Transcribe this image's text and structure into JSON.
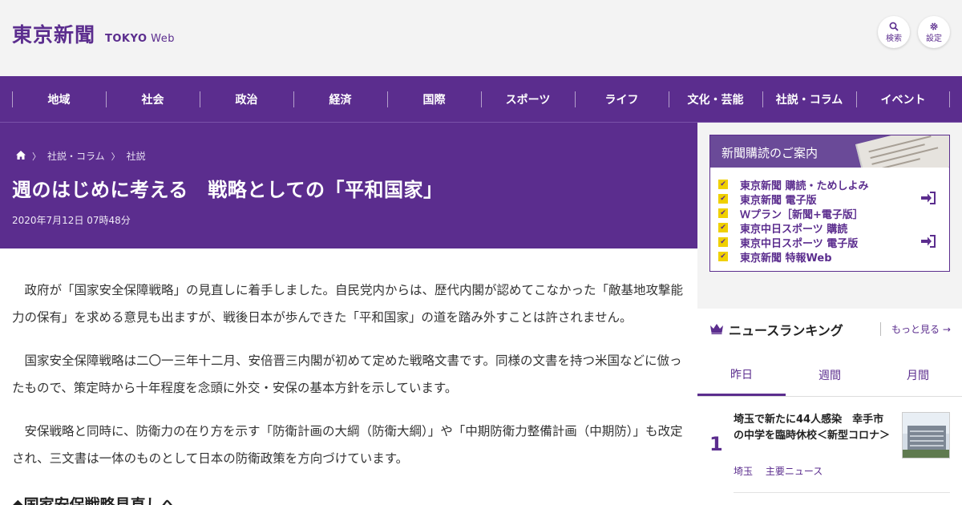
{
  "header": {
    "logo_jp": "東京新聞",
    "logo_en_bold": "TOKYO",
    "logo_en_light": "Web",
    "search_label": "検索",
    "settings_label": "設定",
    "search_icon": "search-icon",
    "settings_icon": "gear-icon"
  },
  "nav": {
    "items": [
      {
        "label": "地域"
      },
      {
        "label": "社会"
      },
      {
        "label": "政治"
      },
      {
        "label": "経済"
      },
      {
        "label": "国際"
      },
      {
        "label": "スポーツ"
      },
      {
        "label": "ライフ"
      },
      {
        "label": "文化・芸能"
      },
      {
        "label": "社説・コラム"
      },
      {
        "label": "イベント"
      }
    ]
  },
  "article": {
    "breadcrumb": {
      "home_icon": "home-icon",
      "items": [
        "社説・コラム",
        "社説"
      ]
    },
    "title": "週のはじめに考える　戦略としての「平和国家」",
    "date": "2020年7月12日 07時48分",
    "paragraphs": [
      "政府が「国家安全保障戦略」の見直しに着手しました。自民党内からは、歴代内閣が認めてこなかった「敵基地攻撃能力の保有」を求める意見も出ますが、戦後日本が歩んできた「平和国家」の道を踏み外すことは許されません。",
      "国家安全保障戦略は二〇一三年十二月、安倍晋三内閣が初めて定めた戦略文書です。同様の文書を持つ米国などに倣ったもので、策定時から十年程度を念頭に外交・安保の基本方針を示しています。",
      "安保戦略と同時に、防衛力の在り方を示す「防衛計画の大綱（防衛大綱）」や「中期防衛力整備計画（中期防）」も改定され、三文書は一体のものとして日本の防衛政策を方向づけています。"
    ],
    "subheading": "◆国家安保戦略見直しへ"
  },
  "sidebar": {
    "subscription": {
      "title": "新聞購読のご案内",
      "items": [
        {
          "label": "東京新聞 購読・ためしよみ"
        },
        {
          "label": "東京新聞 電子版"
        },
        {
          "label": "Ｗプラン［新聞+電子版］"
        },
        {
          "label": "東京中日スポーツ 購読"
        },
        {
          "label": "東京中日スポーツ 電子版"
        },
        {
          "label": "東京新聞 特報Web"
        }
      ],
      "login_icon": "login-icon"
    },
    "ranking": {
      "title": "ニュースランキング",
      "more_label": "もっと見る",
      "tabs": [
        "昨日",
        "週間",
        "月間"
      ],
      "active_tab": "昨日",
      "items": [
        {
          "rank": "1",
          "headline": "埼玉で新たに44人感染　幸手市の中学を臨時休校＜新型コロナ＞",
          "category": "埼玉",
          "tag": "主要ニュース"
        }
      ]
    }
  },
  "colors": {
    "brand": "#5b2d8e",
    "check": "#f0d000",
    "background": "#f3f3f3"
  }
}
